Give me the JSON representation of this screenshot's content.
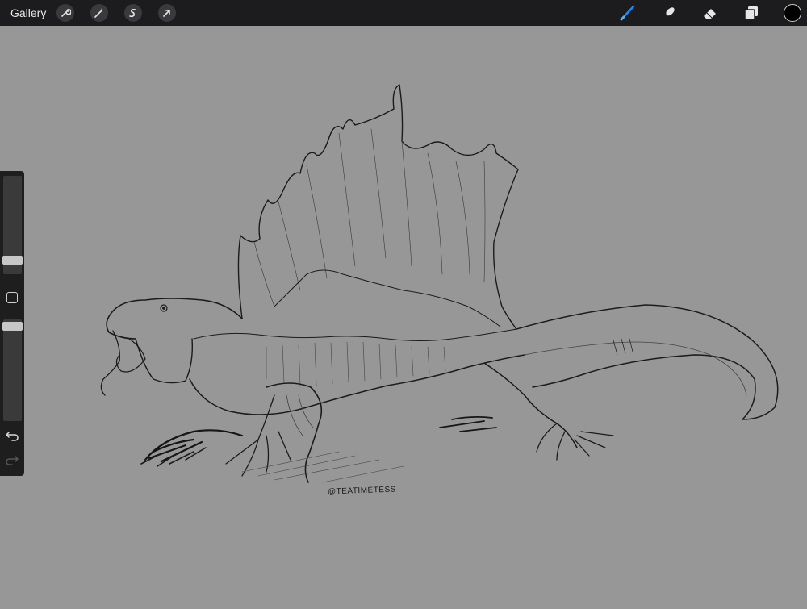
{
  "toolbar": {
    "gallery_label": "Gallery",
    "left_tools": [
      {
        "name": "actions",
        "icon": "wrench-icon"
      },
      {
        "name": "adjustments",
        "icon": "magic-wand-icon"
      },
      {
        "name": "selection",
        "icon": "selection-s-icon"
      },
      {
        "name": "transform",
        "icon": "arrow-cursor-icon"
      }
    ],
    "right_tools": [
      {
        "name": "brush",
        "icon": "brush-icon",
        "active": true
      },
      {
        "name": "smudge",
        "icon": "smudge-icon",
        "active": false
      },
      {
        "name": "eraser",
        "icon": "eraser-icon",
        "active": false
      },
      {
        "name": "layers",
        "icon": "layers-icon",
        "active": false
      }
    ],
    "current_color": "#000000",
    "accent_color": "#1a8cff"
  },
  "canvas": {
    "background": "#979797",
    "artwork": "sketch of a sail-backed reptile",
    "signature": "@TEATIMETESS"
  },
  "sidebar": {
    "brush_size_level": 0.15,
    "opacity_level": 0.85,
    "undo_icon": "undo-icon",
    "redo_icon": "redo-icon"
  }
}
